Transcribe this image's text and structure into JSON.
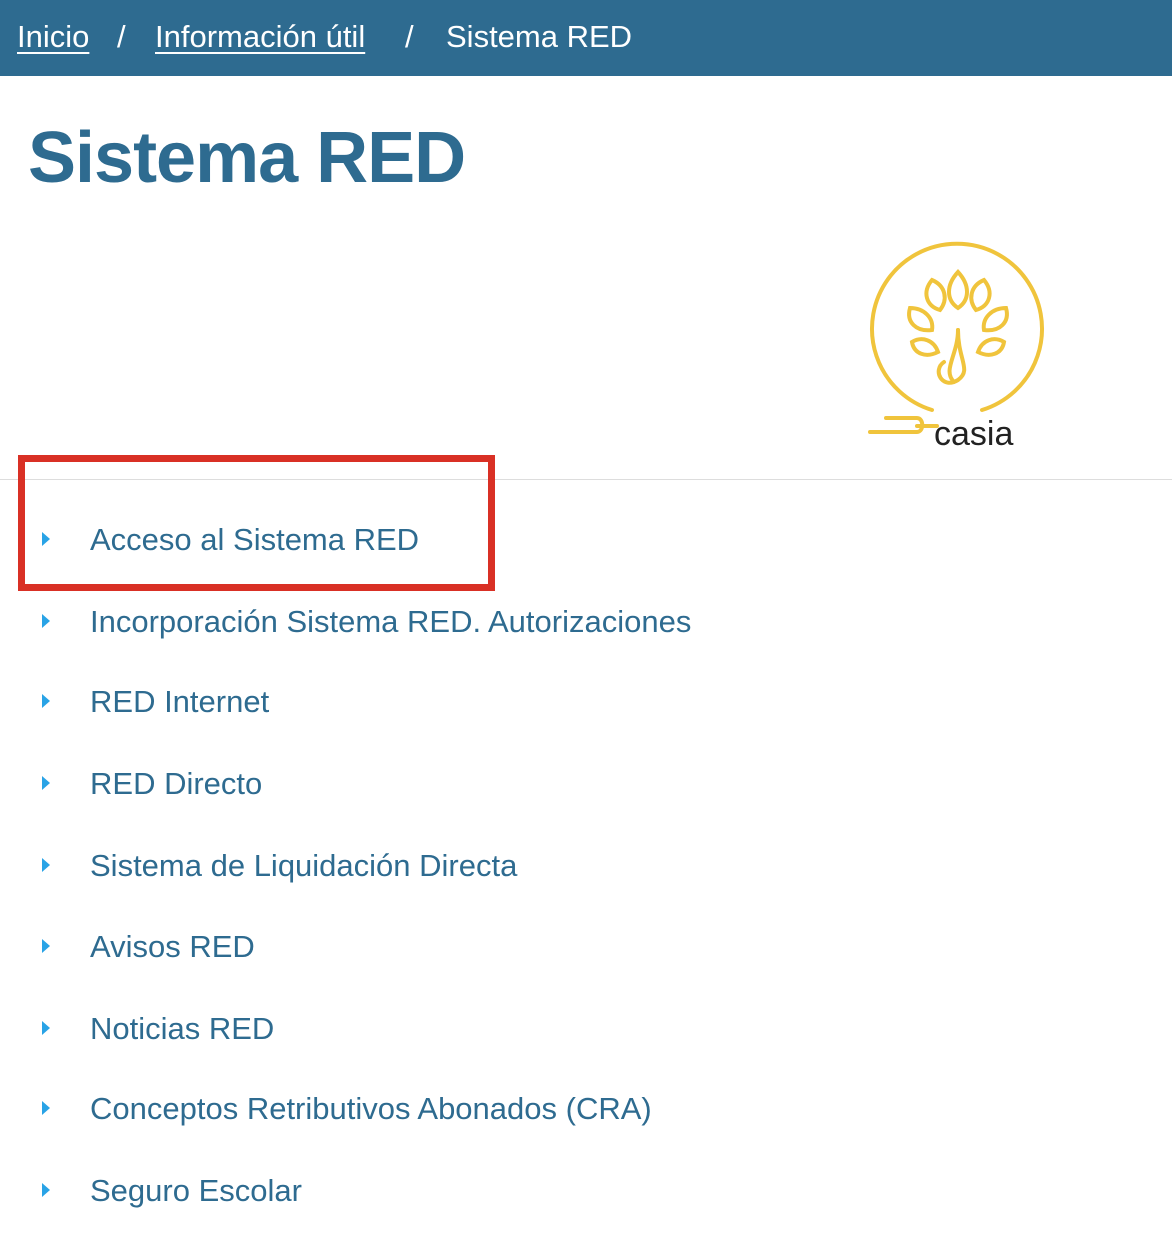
{
  "breadcrumb": {
    "items": [
      {
        "label": "Inicio"
      },
      {
        "label": "Información útil"
      },
      {
        "label": "Sistema RED"
      }
    ],
    "separator": "/"
  },
  "page": {
    "title": "Sistema RED"
  },
  "logo": {
    "text": "casia",
    "color": "#f0c43c"
  },
  "menu": {
    "items": [
      {
        "label": "Acceso al Sistema RED"
      },
      {
        "label": "Incorporación Sistema RED. Autorizaciones"
      },
      {
        "label": "RED Internet"
      },
      {
        "label": "RED Directo"
      },
      {
        "label": "Sistema de Liquidación Directa"
      },
      {
        "label": "Avisos RED"
      },
      {
        "label": "Noticias RED"
      },
      {
        "label": "Conceptos Retributivos Abonados (CRA)"
      },
      {
        "label": "Seguro Escolar"
      }
    ]
  },
  "colors": {
    "header_bg": "#2e6b90",
    "title": "#2e6b90",
    "bullet": "#29a3e6",
    "highlight": "#d93025"
  }
}
